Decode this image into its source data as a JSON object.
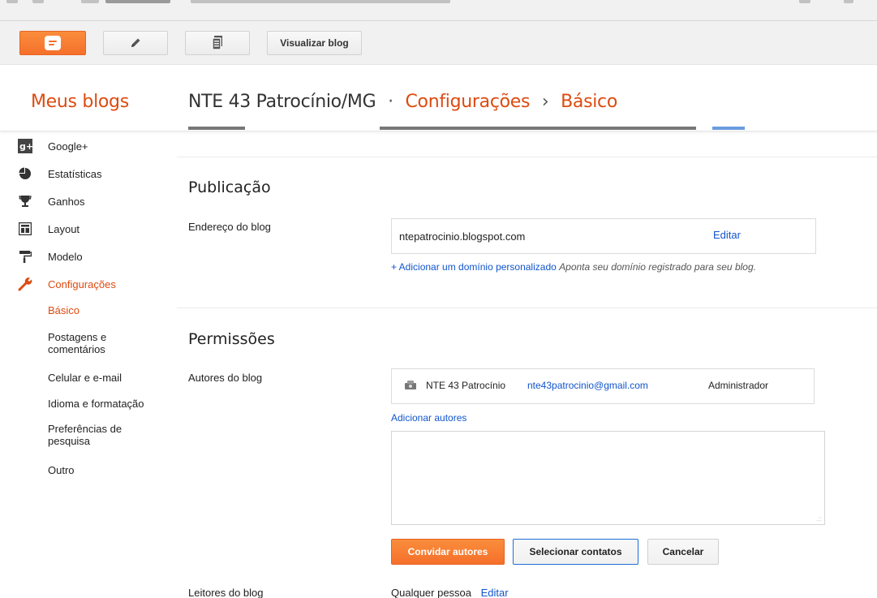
{
  "toolbar": {
    "view_blog_label": "Visualizar blog"
  },
  "header": {
    "my_blogs": "Meus blogs",
    "blog_name": "NTE 43 Patrocínio/MG",
    "separator": "·",
    "crumb_settings": "Configurações",
    "crumb_arrow": "›",
    "crumb_basic": "Básico"
  },
  "sidebar": {
    "items": [
      {
        "label": "Google+",
        "icon": "google-plus-icon"
      },
      {
        "label": "Estatísticas",
        "icon": "pie-chart-icon"
      },
      {
        "label": "Ganhos",
        "icon": "trophy-icon"
      },
      {
        "label": "Layout",
        "icon": "layout-icon"
      },
      {
        "label": "Modelo",
        "icon": "paint-roller-icon"
      },
      {
        "label": "Configurações",
        "icon": "wrench-icon"
      }
    ],
    "sub_items": [
      "Básico",
      "Postagens e comentários",
      "Celular e e-mail",
      "Idioma e formatação",
      "Preferências de pesquisa",
      "Outro"
    ]
  },
  "publicacao": {
    "title": "Publicação",
    "address_label": "Endereço do blog",
    "address_value": "ntepatrocinio.blogspot.com",
    "edit_label": "Editar",
    "add_domain_link": "+ Adicionar um domínio personalizado",
    "add_domain_hint": "Aponta seu domínio registrado para seu blog."
  },
  "permissoes": {
    "title": "Permissões",
    "authors_label": "Autores do blog",
    "author_name": "NTE 43 Patrocínio",
    "author_email": "nte43patrocinio@gmail.com",
    "author_role": "Administrador",
    "add_authors_link": "Adicionar autores",
    "invite_button": "Convidar autores",
    "select_contacts_button": "Selecionar contatos",
    "cancel_button": "Cancelar",
    "readers_label": "Leitores do blog",
    "readers_value": "Qualquer pessoa",
    "readers_edit": "Editar"
  },
  "colors": {
    "accent": "#dd4b10",
    "link": "#1155cc",
    "button_orange": "#f5702b"
  }
}
